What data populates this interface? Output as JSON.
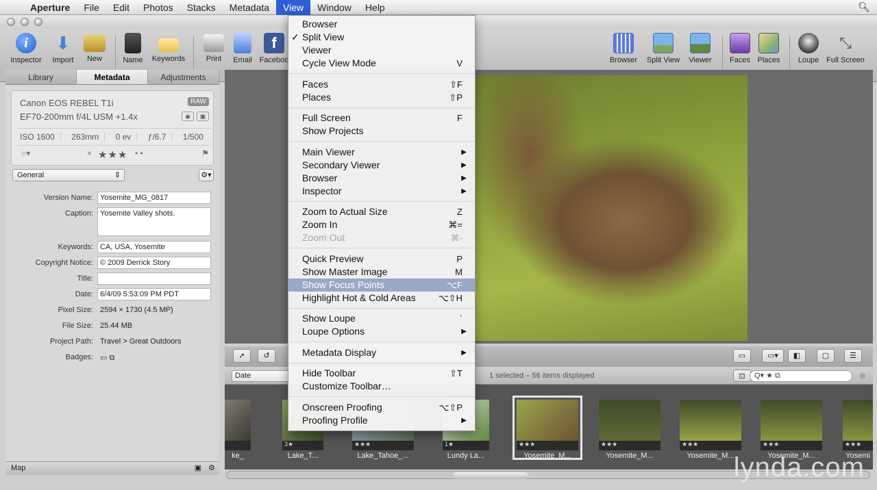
{
  "menubar": {
    "app": "Aperture",
    "items": [
      "File",
      "Edit",
      "Photos",
      "Stacks",
      "Metadata",
      "View",
      "Window",
      "Help"
    ],
    "active": "View"
  },
  "toolbar": {
    "left": [
      "Inspector",
      "Import",
      "New",
      "Name",
      "Keywords",
      "Print",
      "Email",
      "Faceboo"
    ],
    "right": [
      "Browser",
      "Split View",
      "Viewer",
      "Faces",
      "Places",
      "Loupe",
      "Full Screen"
    ]
  },
  "inspector": {
    "tabs": [
      "Library",
      "Metadata",
      "Adjustments"
    ],
    "camera": "Canon EOS REBEL T1i",
    "lens": "EF70-200mm f/4L USM +1.4x",
    "raw_badge": "RAW",
    "exposure": [
      "ISO 1600",
      "263mm",
      "0 ev",
      "ƒ/6.7",
      "1/500"
    ],
    "stars": "★★★",
    "preset": "General",
    "fields": [
      {
        "label": "Version Name:",
        "value": "Yosemite_MG_0817"
      },
      {
        "label": "Caption:",
        "value": "Yosemite Valley shots."
      },
      {
        "label": "Keywords:",
        "value": "CA, USA, Yosemite"
      },
      {
        "label": "Copyright Notice:",
        "value": "© 2009 Derrick Story"
      },
      {
        "label": "Title:",
        "value": ""
      },
      {
        "label": "Date:",
        "value": "6/4/09 5:53:09 PM PDT"
      },
      {
        "label": "Pixel Size:",
        "value": "2594 × 1730 (4.5 MP)"
      },
      {
        "label": "File Size:",
        "value": "25.44 MB"
      },
      {
        "label": "Project Path:",
        "value": "Travel > Great Outdoors"
      },
      {
        "label": "Badges:",
        "value": "▭ ⧉"
      }
    ],
    "bottom_label": "Map"
  },
  "browser": {
    "sort": "Date",
    "status": "1 selected – 56 items displayed",
    "filter": "Q▾ ★ ⧉",
    "thumbnails": [
      {
        "label": "ke_",
        "rating": ""
      },
      {
        "label": "Lake_T...",
        "rating": "3★"
      },
      {
        "label": "Lake_Tahoe_...",
        "rating": "★★★"
      },
      {
        "label": "Lundy La...",
        "rating": "1★"
      },
      {
        "label": "Yosemite_M...",
        "rating": "★★★"
      },
      {
        "label": "Yosemite_M...",
        "rating": "★★★"
      },
      {
        "label": "Yosemite_M...",
        "rating": "★★★"
      },
      {
        "label": "Yosemite_M...",
        "rating": "★★★"
      },
      {
        "label": "Yosemi",
        "rating": "★★★"
      }
    ]
  },
  "view_menu": {
    "items": [
      {
        "label": "Browser",
        "shortcut": "",
        "checked": false,
        "submenu": false,
        "disabled": false
      },
      {
        "label": "Split View",
        "shortcut": "",
        "checked": true,
        "submenu": false,
        "disabled": false
      },
      {
        "label": "Viewer",
        "shortcut": "",
        "checked": false,
        "submenu": false,
        "disabled": false
      },
      {
        "label": "Cycle View Mode",
        "shortcut": "V",
        "checked": false,
        "submenu": false,
        "disabled": false
      },
      {
        "label": "Faces",
        "shortcut": "⇧F",
        "checked": false,
        "submenu": false,
        "disabled": false
      },
      {
        "label": "Places",
        "shortcut": "⇧P",
        "checked": false,
        "submenu": false,
        "disabled": false
      },
      {
        "label": "Full Screen",
        "shortcut": "F",
        "checked": false,
        "submenu": false,
        "disabled": false
      },
      {
        "label": "Show Projects",
        "shortcut": "",
        "checked": false,
        "submenu": false,
        "disabled": false
      },
      {
        "label": "Main Viewer",
        "shortcut": "",
        "checked": false,
        "submenu": true,
        "disabled": false
      },
      {
        "label": "Secondary Viewer",
        "shortcut": "",
        "checked": false,
        "submenu": true,
        "disabled": false
      },
      {
        "label": "Browser",
        "shortcut": "",
        "checked": false,
        "submenu": true,
        "disabled": false
      },
      {
        "label": "Inspector",
        "shortcut": "",
        "checked": false,
        "submenu": true,
        "disabled": false
      },
      {
        "label": "Zoom to Actual Size",
        "shortcut": "Z",
        "checked": false,
        "submenu": false,
        "disabled": false
      },
      {
        "label": "Zoom In",
        "shortcut": "⌘=",
        "checked": false,
        "submenu": false,
        "disabled": false
      },
      {
        "label": "Zoom Out",
        "shortcut": "⌘-",
        "checked": false,
        "submenu": false,
        "disabled": true
      },
      {
        "label": "Quick Preview",
        "shortcut": "P",
        "checked": false,
        "submenu": false,
        "disabled": false
      },
      {
        "label": "Show Master Image",
        "shortcut": "M",
        "checked": false,
        "submenu": false,
        "disabled": false
      },
      {
        "label": "Show Focus Points",
        "shortcut": "⌥F",
        "checked": false,
        "submenu": false,
        "disabled": false
      },
      {
        "label": "Highlight Hot & Cold Areas",
        "shortcut": "⌥⇧H",
        "checked": false,
        "submenu": false,
        "disabled": false
      },
      {
        "label": "Show Loupe",
        "shortcut": "`",
        "checked": false,
        "submenu": false,
        "disabled": false
      },
      {
        "label": "Loupe Options",
        "shortcut": "",
        "checked": false,
        "submenu": true,
        "disabled": false
      },
      {
        "label": "Metadata Display",
        "shortcut": "",
        "checked": false,
        "submenu": true,
        "disabled": false
      },
      {
        "label": "Hide Toolbar",
        "shortcut": "⇧T",
        "checked": false,
        "submenu": false,
        "disabled": false
      },
      {
        "label": "Customize Toolbar…",
        "shortcut": "",
        "checked": false,
        "submenu": false,
        "disabled": false
      },
      {
        "label": "Onscreen Proofing",
        "shortcut": "⌥⇧P",
        "checked": false,
        "submenu": false,
        "disabled": false
      },
      {
        "label": "Proofing Profile",
        "shortcut": "",
        "checked": false,
        "submenu": true,
        "disabled": false
      }
    ],
    "highlighted": "Show Focus Points"
  },
  "watermark": "lynda.com",
  "colors": {
    "menu_highlight": "#98a8c8",
    "menubar_active": "#2e5fd6"
  }
}
